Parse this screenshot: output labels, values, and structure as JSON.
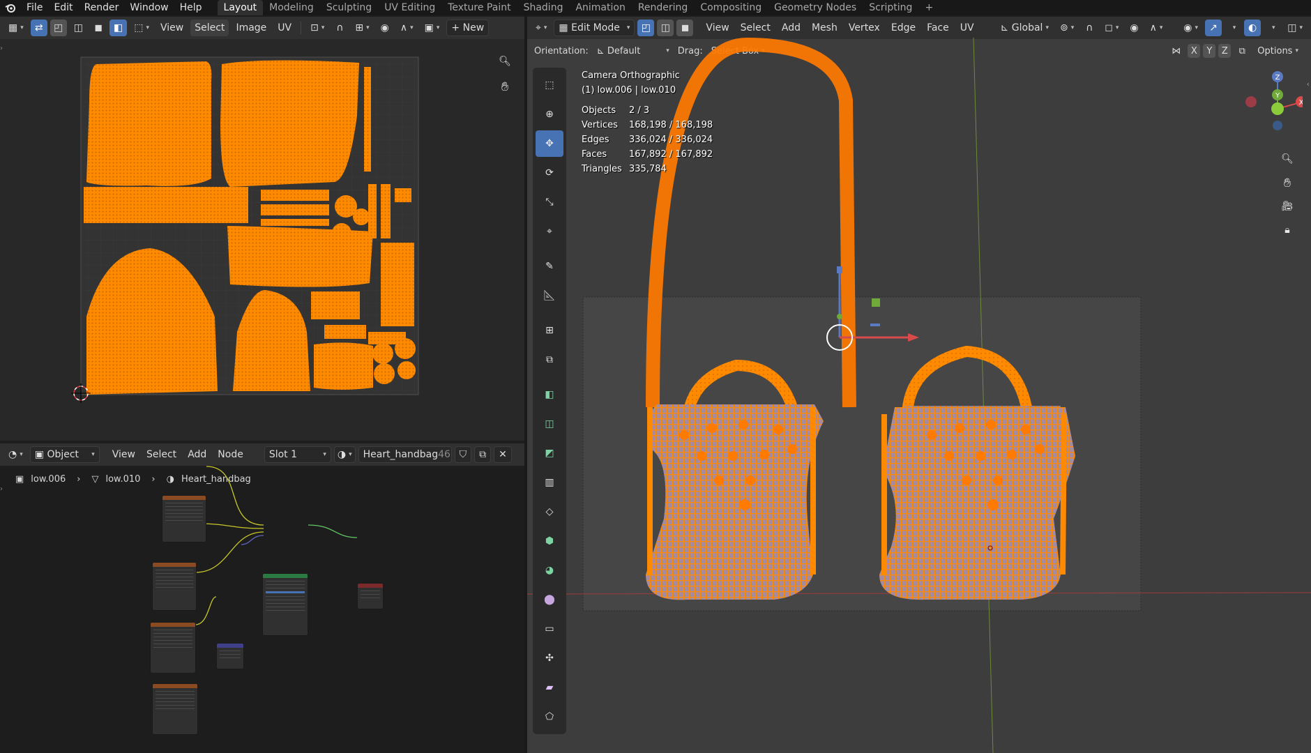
{
  "topbar": {
    "menus": [
      "File",
      "Edit",
      "Render",
      "Window",
      "Help"
    ],
    "workspaces": [
      "Layout",
      "Modeling",
      "Sculpting",
      "UV Editing",
      "Texture Paint",
      "Shading",
      "Animation",
      "Rendering",
      "Compositing",
      "Geometry Nodes",
      "Scripting",
      "+"
    ],
    "active_workspace": "Layout"
  },
  "uv_editor": {
    "menus": [
      "View",
      "Select",
      "Image",
      "UV"
    ],
    "new_label": "New"
  },
  "viewport": {
    "mode": "Edit Mode",
    "menus": [
      "View",
      "Select",
      "Add",
      "Mesh",
      "Vertex",
      "Edge",
      "Face",
      "UV"
    ],
    "transform_orientation": "Global",
    "orientation_label": "Orientation:",
    "orientation_value": "Default",
    "drag_label": "Drag:",
    "drag_value": "Select Box",
    "axes": [
      "X",
      "Y",
      "Z"
    ],
    "options_label": "Options",
    "camera": "Camera Orthographic",
    "object_line": "(1) low.006 | low.010",
    "stats": [
      {
        "label": "Objects",
        "value": "2 / 3"
      },
      {
        "label": "Vertices",
        "value": "168,198 / 168,198"
      },
      {
        "label": "Edges",
        "value": "336,024 / 336,024"
      },
      {
        "label": "Faces",
        "value": "167,892 / 167,892"
      },
      {
        "label": "Triangles",
        "value": "335,784"
      }
    ],
    "gizmo_axes": {
      "z": "Z",
      "y": "Y",
      "x": "X"
    }
  },
  "node_editor": {
    "object_mode": "Object",
    "menus": [
      "View",
      "Select",
      "Add",
      "Node"
    ],
    "slot": "Slot 1",
    "material": "Heart_handbag",
    "user_count": "46",
    "breadcrumb": [
      "low.006",
      "low.010",
      "Heart_handbag"
    ]
  },
  "colors": {
    "accent": "#4772b3",
    "selection": "#ff8a00",
    "header": "#303030",
    "background": "#282828"
  }
}
